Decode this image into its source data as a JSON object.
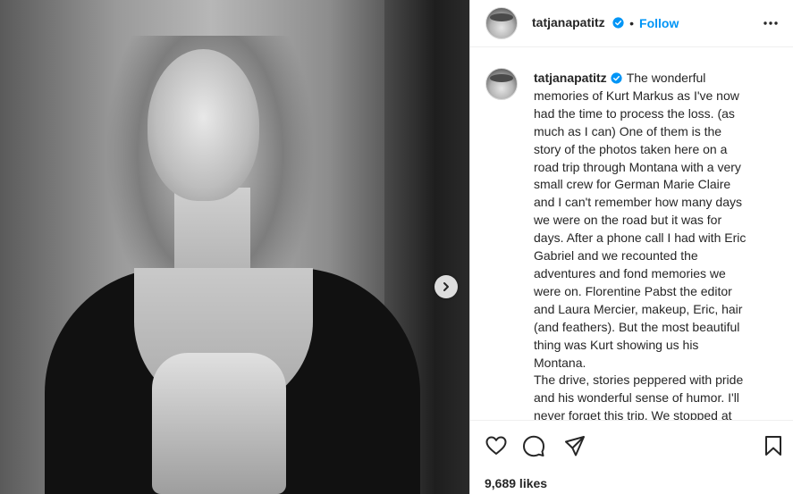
{
  "post": {
    "username": "tatjanapatitz",
    "follow_label": "Follow",
    "separator": "•",
    "caption_lines": [
      "The wonderful",
      "memories of Kurt Markus as I've now",
      "had the time to process the loss. (as",
      "much as I can) One of them is the",
      "story of the photos taken here on a",
      "road trip through Montana with a very",
      "small crew for German Marie Claire",
      "and I can't remember how many days",
      "we were on the road but it was for",
      "days. After a phone call I had with Eric",
      "Gabriel and we recounted the",
      "adventures and fond memories we",
      "were on. Florentine Pabst the editor",
      "and Laura Mercier, makeup, Eric, hair",
      "(and feathers). But the most beautiful",
      "thing was Kurt showing us his",
      "Montana.",
      "The drive, stories peppered with pride",
      "and his wonderful sense of humor. I'll",
      "never forget this trip. We stopped at"
    ],
    "likes": "9,689 likes"
  },
  "icons": {
    "verified": "verified-badge-icon",
    "more": "more-options-icon",
    "next": "chevron-right-icon",
    "like": "heart-icon",
    "comment": "comment-icon",
    "share": "share-icon",
    "save": "bookmark-icon"
  },
  "colors": {
    "accent": "#0095f6",
    "text": "#262626",
    "border": "#dbdbdb"
  }
}
